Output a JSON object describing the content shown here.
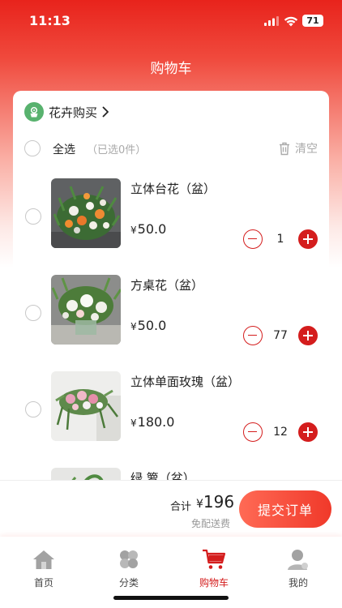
{
  "status_bar": {
    "time": "11:13",
    "battery": "71"
  },
  "header": {
    "title": "购物车"
  },
  "shop": {
    "name": "花卉购买",
    "icon": "flower-pot-icon"
  },
  "select_bar": {
    "select_all": "全选",
    "selected_count": "（已选0件）",
    "clear": "清空"
  },
  "items": [
    {
      "name": "立体台花（盆）",
      "currency": "¥",
      "price": "50.0",
      "quantity": "1"
    },
    {
      "name": "方桌花（盆）",
      "currency": "¥",
      "price": "50.0",
      "quantity": "77"
    },
    {
      "name": "立体单面玫瑰（盆）",
      "currency": "¥",
      "price": "180.0",
      "quantity": "12"
    },
    {
      "name": "绿 箩（盆）"
    }
  ],
  "checkout": {
    "total_label": "合计",
    "currency": "¥",
    "total": "196",
    "shipping_note": "免配送费",
    "submit_label": "提交订单"
  },
  "tabbar": {
    "items": [
      {
        "label": "首页",
        "icon": "home-icon"
      },
      {
        "label": "分类",
        "icon": "category-icon"
      },
      {
        "label": "购物车",
        "icon": "cart-icon",
        "active": true
      },
      {
        "label": "我的",
        "icon": "profile-icon"
      }
    ]
  },
  "colors": {
    "brand_red": "#d41d1d",
    "header_red": "#e8231c",
    "submit_gradient_start": "#ff6a55",
    "submit_gradient_end": "#f0392a"
  }
}
